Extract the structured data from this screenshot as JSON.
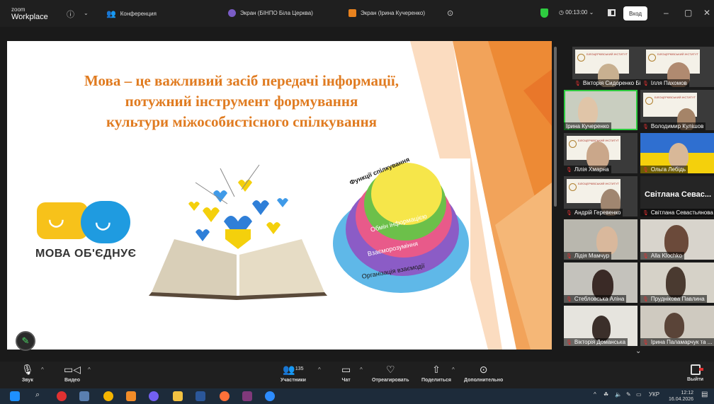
{
  "app": {
    "brand_top": "zoom",
    "brand_bottom": "Workplace"
  },
  "header": {
    "conference_label": "Конференция",
    "tabs": [
      {
        "label": "Экран (БІНПО Біла Церква)",
        "color": "#7a5cc6"
      },
      {
        "label": "Экран (Ірина Кучеренко)",
        "color": "#e8821e"
      }
    ],
    "timer": "00:13:00",
    "signin_label": "Вход"
  },
  "slide": {
    "title_lines": [
      "Мова – це важливий засіб передачі інформації,",
      "потужний інструмент формування",
      "культури міжособистісного спілкування"
    ],
    "logo_text": "МОВА ОБ'ЄДНУЄ",
    "pyramid_levels": [
      "Функції спілкування",
      "Обмін інформацією",
      "Взаєморозуміння",
      "Організація взаємодії"
    ]
  },
  "participants": [
    {
      "name": "Вікторія Сидоренко Бі...",
      "muted": true,
      "active": false
    },
    {
      "name": "Ілля Пахомов",
      "muted": true,
      "active": false
    },
    {
      "name": "Ірина Кучеренко",
      "muted": false,
      "active": true
    },
    {
      "name": "Володимир Кулішов",
      "muted": true,
      "active": false
    },
    {
      "name": "Лілія Хмарна",
      "muted": true,
      "active": false
    },
    {
      "name": "Ольга Лебідь",
      "muted": true,
      "active": false
    },
    {
      "name": "Андрій Геревенко",
      "muted": true,
      "active": false
    },
    {
      "name": "Світлана Севастьянова",
      "muted": true,
      "active": false,
      "big_name": "Світлана Севас..."
    },
    {
      "name": "Лідія Мамчур",
      "muted": true,
      "active": false
    },
    {
      "name": "Alla Klochko",
      "muted": true,
      "active": false
    },
    {
      "name": "Стебловська Аліна",
      "muted": true,
      "active": false
    },
    {
      "name": "Пруднікова Павлина",
      "muted": true,
      "active": false
    },
    {
      "name": "Вікторія Доманська",
      "muted": true,
      "active": false
    },
    {
      "name": "Ірина Паламарчук та ...",
      "muted": true,
      "active": false
    }
  ],
  "toolbar": {
    "audio": "Звук",
    "video": "Видео",
    "participants": "Участники",
    "participants_count": "135",
    "chat": "Чат",
    "react": "Отреагировать",
    "share": "Поделиться",
    "more": "Дополнительно",
    "leave": "Выйти"
  },
  "taskbar": {
    "lang": "УКР",
    "time": "12:12",
    "date": "16.04.2026"
  }
}
